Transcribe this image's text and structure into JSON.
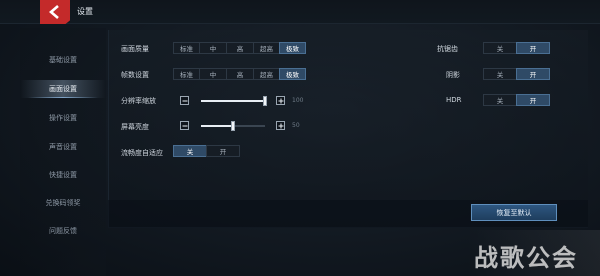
{
  "header": {
    "title": "设置"
  },
  "sidebar": {
    "items": [
      {
        "label": "基础设置"
      },
      {
        "label": "画面设置"
      },
      {
        "label": "操作设置"
      },
      {
        "label": "声音设置"
      },
      {
        "label": "快捷设置"
      },
      {
        "label": "兑换码领奖"
      },
      {
        "label": "问题反馈"
      }
    ],
    "active_index": 1
  },
  "graphics": {
    "quality": {
      "label": "画面质量",
      "options": [
        "标准",
        "中",
        "高",
        "超高",
        "极致"
      ],
      "selected": "极致"
    },
    "framerate": {
      "label": "帧数设置",
      "options": [
        "标准",
        "中",
        "高",
        "超高",
        "极致"
      ],
      "selected": "极致"
    },
    "resolution": {
      "label": "分辨率缩放",
      "value": "100",
      "level": 1.0
    },
    "brightness": {
      "label": "屏幕亮度",
      "value": "50",
      "level": 0.5
    },
    "adaptive": {
      "label": "流畅度自适应",
      "off": "关",
      "on": "开",
      "selected": "关"
    },
    "antialias": {
      "label": "抗锯齿",
      "off": "关",
      "on": "开",
      "selected": "开"
    },
    "shadow": {
      "label": "阴影",
      "off": "关",
      "on": "开",
      "selected": "开"
    },
    "hdr": {
      "label": "HDR",
      "off": "关",
      "on": "开",
      "selected": "开"
    }
  },
  "icons": {
    "back": "back-chevron-icon",
    "minus": "minus-icon",
    "plus": "plus-icon"
  },
  "restore_button": {
    "label": "恢复至默认"
  },
  "watermark": {
    "text": "战歌公会"
  },
  "colors": {
    "accent": "#2f4a66",
    "back_red": "#c42a2a",
    "button_blue": "#2e5680"
  }
}
